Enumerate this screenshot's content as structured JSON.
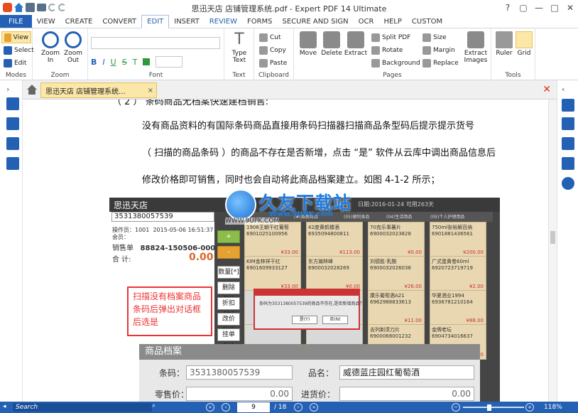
{
  "window": {
    "title": "思迅天店 店铺管理系统.pdf  -  Expert PDF 14 Ultimate"
  },
  "tabs": [
    "FILE",
    "VIEW",
    "CREATE",
    "CONVERT",
    "EDIT",
    "INSERT",
    "REVIEW",
    "FORMS",
    "SECURE AND SIGN",
    "OCR",
    "HELP",
    "CUSTOM"
  ],
  "ribbon": {
    "modes": {
      "label": "Modes",
      "view": "View",
      "select": "Select",
      "edit": "Edit"
    },
    "zoom": {
      "label": "Zoom",
      "zoom_in": "Zoom In",
      "zoom_out": "Zoom Out"
    },
    "font": {
      "label": "Font",
      "bold": "B",
      "italic": "I",
      "underline": "U",
      "strike": "S",
      "t": "T"
    },
    "text": {
      "label": "Text",
      "type_text": "Type Text"
    },
    "clipboard": {
      "label": "Clipboard",
      "cut": "Cut",
      "copy": "Copy",
      "paste": "Paste"
    },
    "pages": {
      "label": "Pages",
      "move": "Move",
      "delete": "Delete",
      "extract": "Extract",
      "split": "Split PDF",
      "rotate": "Rotate",
      "background": "Background",
      "size": "Size",
      "margin": "Margin",
      "replace": "Replace",
      "extract_images": "Extract Images"
    },
    "tools": {
      "label": "Tools",
      "ruler": "Ruler",
      "grid": "Grid"
    }
  },
  "doc_tab": {
    "title": "思迅天店 店铺管理系统...",
    "close": "×"
  },
  "page": {
    "lines": [
      "（ 2 ）   条码商品无档案快速建档销售:",
      "没有商品资料的有国际条码商品直接用条码扫描器扫描商品条型码后提示提示货号",
      "（ 扫描的商品条码 ）的商品不存在是否新增，点击 “是” 软件从云库中调出商品信息后",
      "修改价格即可销售，同时也会自动将此商品档案建立。如图 4-1-2 所示；"
    ]
  },
  "screenshot": {
    "brand": "思迅天店",
    "barcode": "3531380057539",
    "operator_label": "操作员：",
    "operator": "1001",
    "date": "2015-05-06 16:51:37",
    "member_label": "会员：",
    "sales_no_label": "销售单",
    "sales_no": "88824-150506-0001",
    "total_label": "合  计:",
    "total": "0.00",
    "buttons": [
      "+",
      "-",
      "数量[*]",
      "删除[U]",
      "折扣[D]",
      "改价[W]",
      "挂单[H]"
    ],
    "redbox_text": "扫描没有档案商品条码后弹出对话框后选是",
    "dialog_msg": "条码为3531380057539的商品不存在,是否新增商品？",
    "dialog_yes": "是(Y)",
    "dialog_no": "否(N)",
    "archive_title": "商品档案",
    "archive_barcode_label": "条码：",
    "archive_barcode": "3531380057539",
    "archive_name_label": "品名：",
    "archive_name": "威德蓝庄园红葡萄酒",
    "archive_price_label": "零售价：",
    "archive_price": "0.00",
    "archive_cost_label": "进货价：",
    "archive_cost": "0.00",
    "cells": [
      {
        "name": "1906王朝干红葡萄",
        "code": "6901025100956",
        "price": "¥33.00"
      },
      {
        "name": "42度黄鹤楼酒",
        "code": "6935094800811",
        "price": "¥113.00"
      },
      {
        "name": "70克乐事薯片",
        "code": "6900032023828",
        "price": "¥0.00"
      },
      {
        "name": "750ml张裕解百纳",
        "code": "6901881436561",
        "price": "¥200.00"
      },
      {
        "name": "KIM金林祥干红",
        "code": "6901609933127",
        "price": "¥33.00"
      },
      {
        "name": "东方瀚林峰",
        "code": "6900032028269",
        "price": "¥0.00"
      },
      {
        "name": "刘德胜-乳酸",
        "code": "6900032026036",
        "price": "¥26.00"
      },
      {
        "name": "广式蛋黄卷60ml",
        "code": "6920723719719",
        "price": "¥2.00"
      },
      {
        "name": "",
        "code": "",
        "price": ""
      },
      {
        "name": "",
        "code": "",
        "price": ""
      },
      {
        "name": "康乐葡萄酒A21",
        "code": "6962988833613",
        "price": "¥11.00"
      },
      {
        "name": "华夏酒业1994",
        "code": "6936781210164",
        "price": "¥88.00"
      },
      {
        "name": "",
        "code": "",
        "price": ""
      },
      {
        "name": "",
        "code": "",
        "price": ""
      },
      {
        "name": "吉列剃须刀片",
        "code": "6900068001232",
        "price": "¥18.00"
      },
      {
        "name": "金牌老坛",
        "code": "6904734016637",
        "price": "¥46.00"
      }
    ],
    "cats": [
      "(#)酒类商品",
      "(05)便利食品",
      "(04)生活用品",
      "(05)个人护理用品"
    ],
    "topbar_date": "日期:2016-01-24  可用263天"
  },
  "watermark": {
    "big": "久友下载站",
    "url": "WWW.9UPK.COM",
    "url2": "Www.9UPK.com"
  },
  "status": {
    "search": "Search",
    "page": "9",
    "total": "/ 18",
    "zoom": "118%"
  }
}
